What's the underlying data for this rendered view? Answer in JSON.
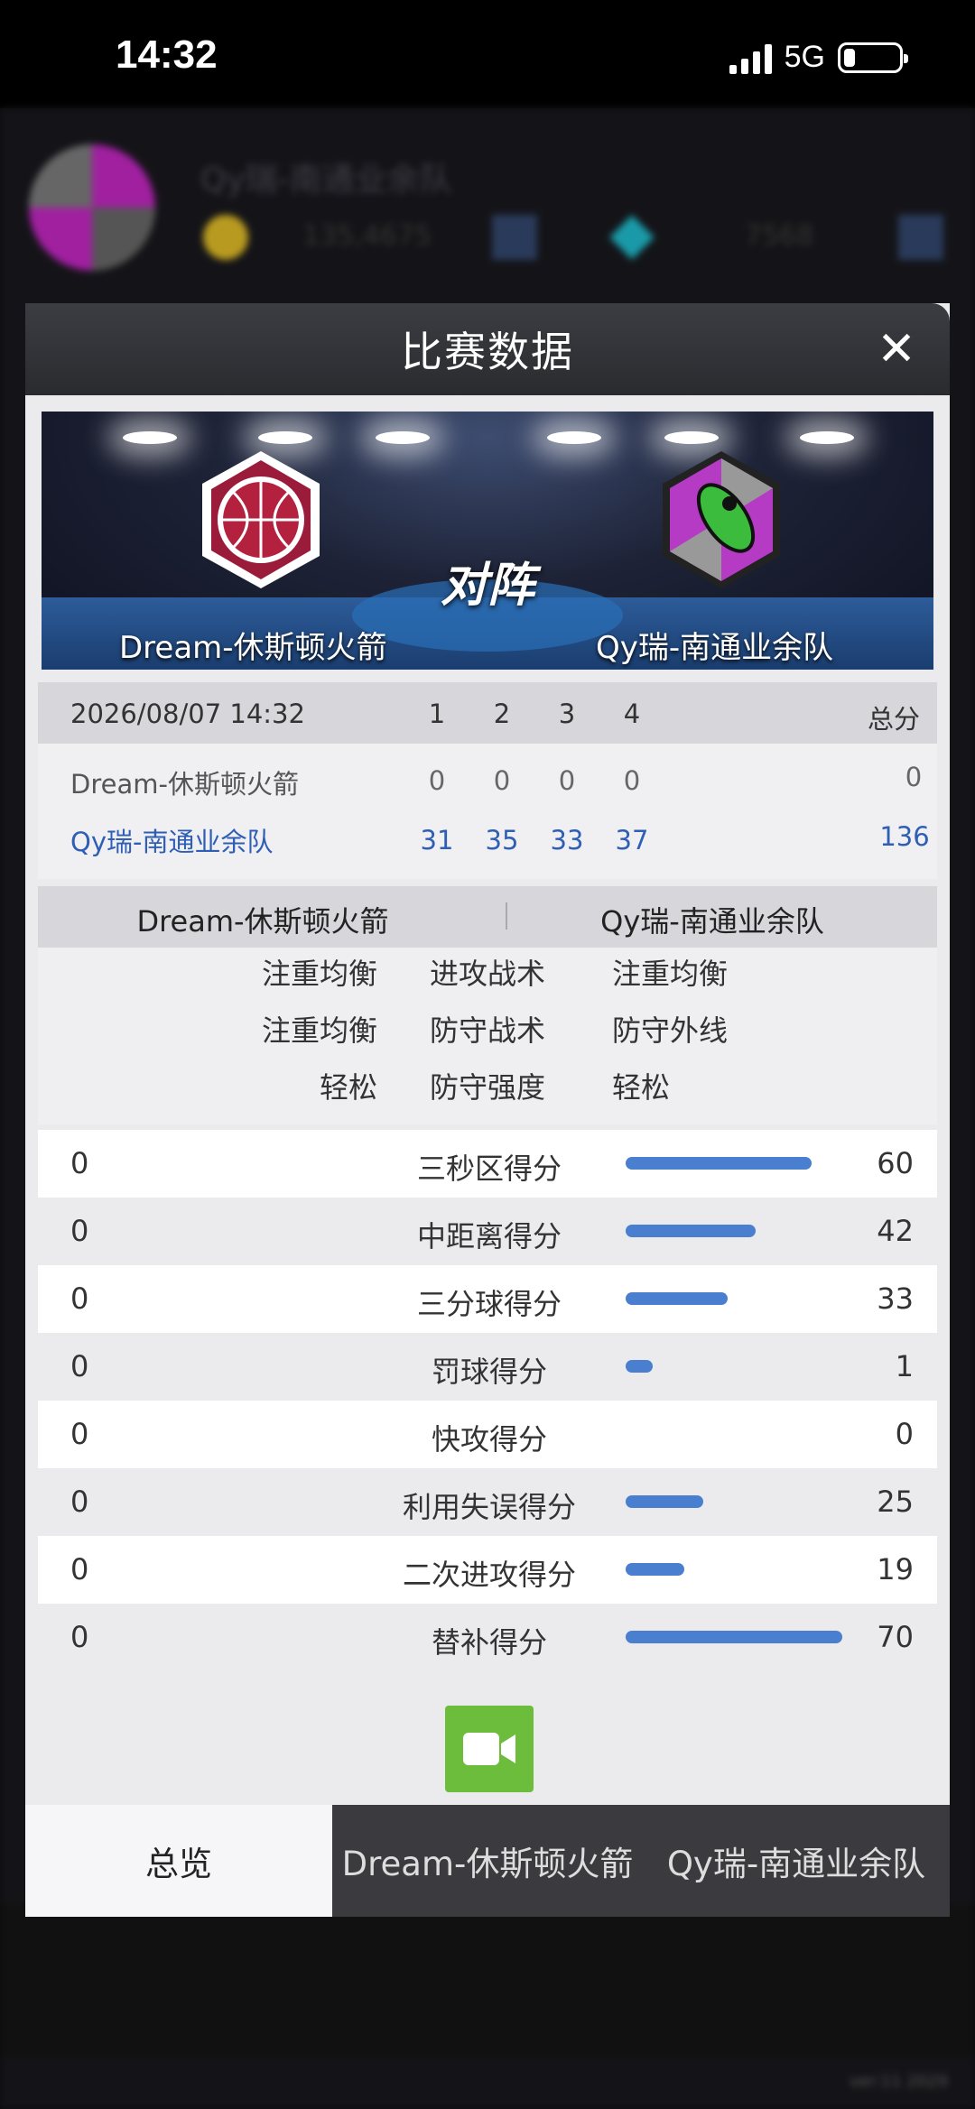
{
  "status_bar": {
    "time": "14:32",
    "network": "5G",
    "battery_level": 0.2
  },
  "background": {
    "team_name": "Qy瑞-南通业余队",
    "coins": "135,4675",
    "gems": "7568",
    "version": "ver:11  2029"
  },
  "modal": {
    "title": "比赛数据",
    "vs_label": "对阵",
    "home_team": "Dream-休斯顿火箭",
    "away_team": "Qy瑞-南通业余队",
    "colors": {
      "home_logo": "#9b1c3a",
      "away_logo": "#b53bc4",
      "bar": "#4a7fd0",
      "video_button": "#6dbd3c",
      "away_text": "#2f5eb5"
    }
  },
  "scoreboard": {
    "date": "2026/08/07 14:32",
    "quarters": [
      "1",
      "2",
      "3",
      "4"
    ],
    "total_label": "总分",
    "home": {
      "name": "Dream-休斯顿火箭",
      "scores": [
        "0",
        "0",
        "0",
        "0"
      ],
      "total": "0"
    },
    "away": {
      "name": "Qy瑞-南通业余队",
      "scores": [
        "31",
        "35",
        "33",
        "37"
      ],
      "total": "136"
    }
  },
  "tactics": {
    "home_team": "Dream-休斯顿火箭",
    "away_team": "Qy瑞-南通业余队",
    "rows": [
      {
        "home": "注重均衡",
        "label": "进攻战术",
        "away": "注重均衡"
      },
      {
        "home": "注重均衡",
        "label": "防守战术",
        "away": "防守外线"
      },
      {
        "home": "轻松",
        "label": "防守强度",
        "away": "轻松"
      }
    ]
  },
  "stats": {
    "max_value": 70,
    "rows": [
      {
        "label": "三秒区得分",
        "home": "0",
        "away": "60",
        "away_value": 60
      },
      {
        "label": "中距离得分",
        "home": "0",
        "away": "42",
        "away_value": 42
      },
      {
        "label": "三分球得分",
        "home": "0",
        "away": "33",
        "away_value": 33
      },
      {
        "label": "罚球得分",
        "home": "0",
        "away": "1",
        "away_value": 1
      },
      {
        "label": "快攻得分",
        "home": "0",
        "away": "0",
        "away_value": 0
      },
      {
        "label": "利用失误得分",
        "home": "0",
        "away": "25",
        "away_value": 25
      },
      {
        "label": "二次进攻得分",
        "home": "0",
        "away": "19",
        "away_value": 19
      },
      {
        "label": "替补得分",
        "home": "0",
        "away": "70",
        "away_value": 70
      }
    ]
  },
  "tabs": {
    "overview": "总览",
    "home": "Dream-休斯顿火箭",
    "away": "Qy瑞-南通业余队"
  }
}
